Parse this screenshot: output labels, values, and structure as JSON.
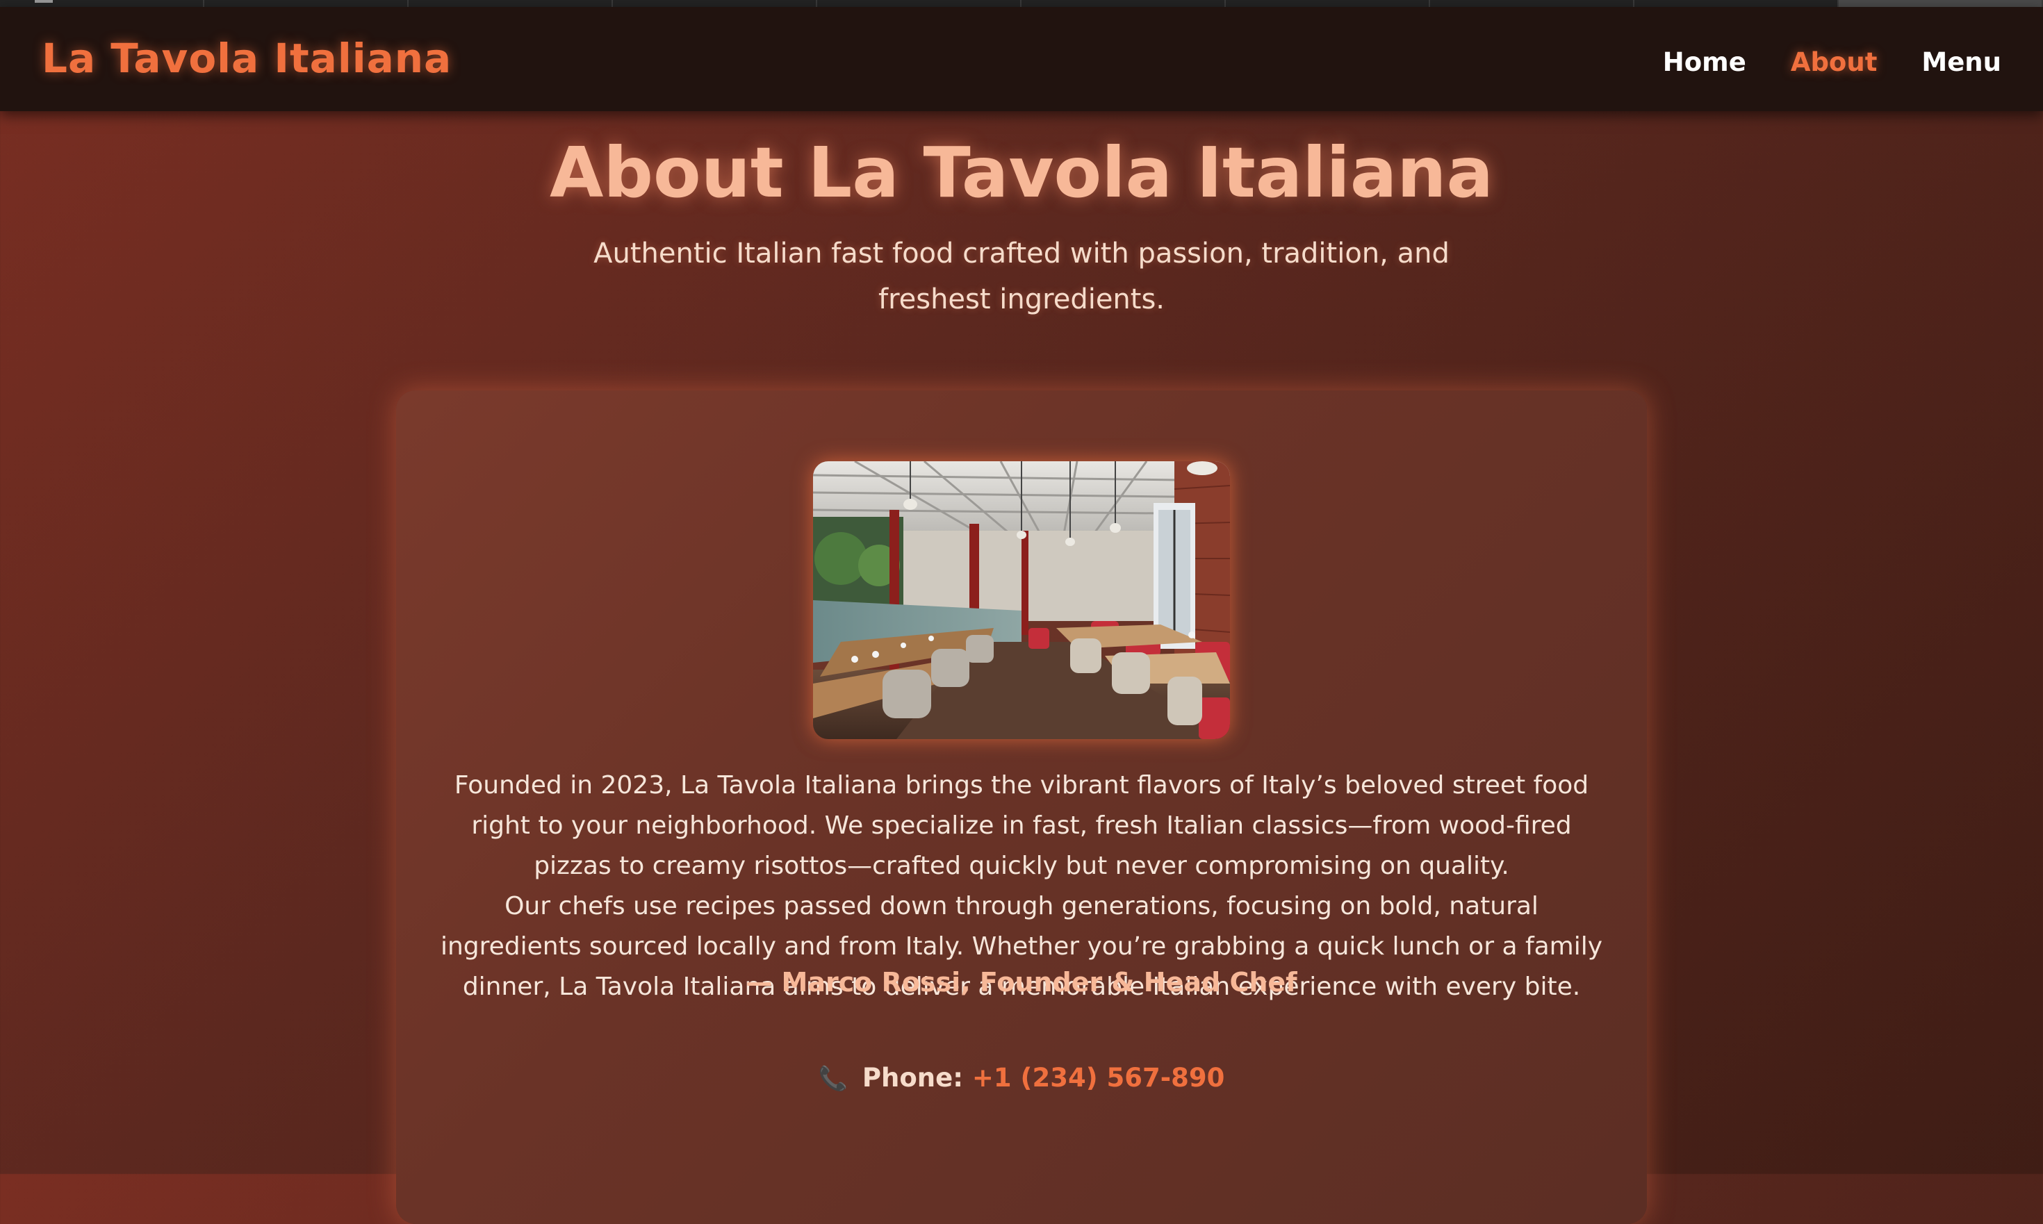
{
  "header": {
    "brand": "La Tavola Italiana",
    "nav": [
      {
        "label": "Home"
      },
      {
        "label": "About"
      },
      {
        "label": "Menu"
      }
    ],
    "active_nav": "About"
  },
  "hero": {
    "title": "About La Tavola Italiana",
    "subtitle": "Authentic Italian fast food crafted with passion, tradition, and freshest ingredients."
  },
  "about": {
    "paragraphs": [
      "Founded in 2023, La Tavola Italiana brings the vibrant flavors of Italy’s beloved street food right to your neighborhood. We specialize in fast, fresh Italian classics—from wood-fired pizzas to creamy risottos—crafted quickly but never compromising on quality.",
      "Our chefs use recipes passed down through generations, focusing on bold, natural ingredients sourced locally and from Italy. Whether you’re grabbing a quick lunch or a family dinner, La Tavola Italiana aims to deliver a memorable Italian experience with every bite."
    ],
    "signature": "— Marco Rossi, Founder & Head Chef",
    "contact": {
      "icon": "phone-icon",
      "label": "Phone:",
      "phone": "+1 (234) 567-890"
    }
  },
  "colors": {
    "accent": "#f0703e",
    "title": "#f7b898",
    "header_bg": "#21130f",
    "card_bg": "#6a3327"
  }
}
